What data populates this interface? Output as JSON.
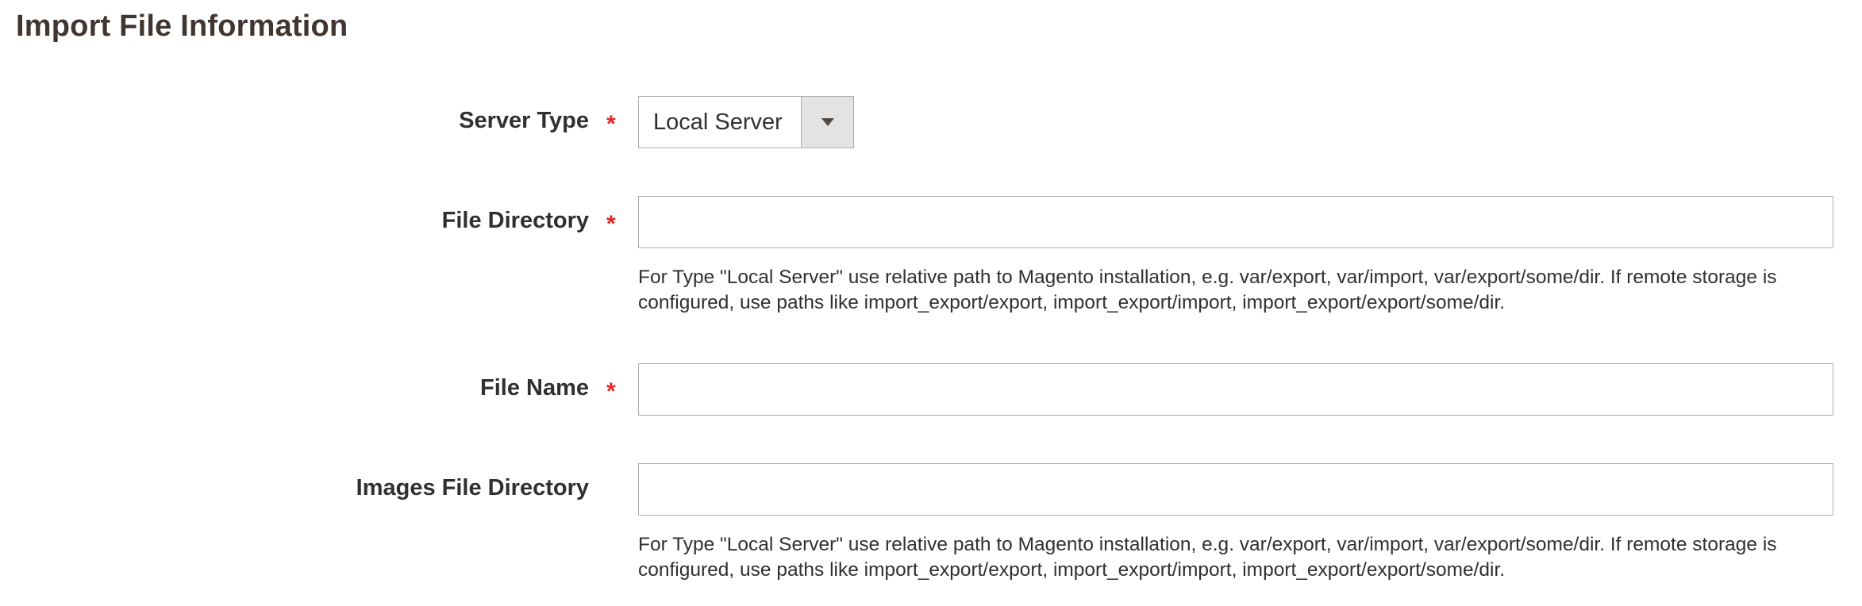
{
  "section": {
    "title": "Import File Information"
  },
  "fields": {
    "server_type": {
      "label": "Server Type",
      "required_mark": "*",
      "selected": "Local Server"
    },
    "file_directory": {
      "label": "File Directory",
      "required_mark": "*",
      "value": "",
      "note": "For Type \"Local Server\" use relative path to Magento installation, e.g. var/export, var/import, var/export/some/dir. If remote storage is configured, use paths like import_export/export, import_export/import, import_export/export/some/dir."
    },
    "file_name": {
      "label": "File Name",
      "required_mark": "*",
      "value": ""
    },
    "images_file_directory": {
      "label": "Images File Directory",
      "value": "",
      "note": "For Type \"Local Server\" use relative path to Magento installation, e.g. var/export, var/import, var/export/some/dir. If remote storage is configured, use paths like import_export/export, import_export/import, import_export/export/some/dir."
    }
  },
  "colors": {
    "required_star": "#e22626",
    "title": "#41362f",
    "border": "#adadad",
    "select_arrow_bg": "#e3e3e3"
  },
  "icons": {
    "select_arrow": "caret-down-icon"
  }
}
